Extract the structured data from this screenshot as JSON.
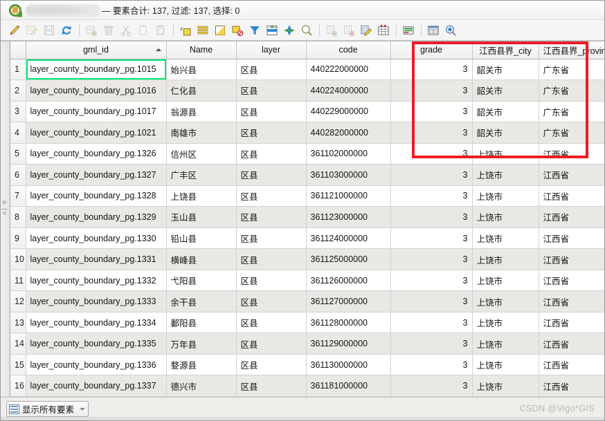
{
  "window": {
    "title_suffix": "— 要素合计: 137, 过滤: 137, 选择: 0",
    "logo_name": "qgis-logo",
    "redacted_label": ""
  },
  "toolbar": {
    "buttons": [
      {
        "name": "toggle-editing-icon",
        "title": "切换编辑模式",
        "enabled": true
      },
      {
        "name": "edit-form-icon",
        "title": "多字段编辑",
        "enabled": false
      },
      {
        "name": "save-edits-icon",
        "title": "保存编辑内容",
        "enabled": false
      },
      {
        "name": "reload-icon",
        "title": "重新载入表格",
        "enabled": true
      },
      {
        "name": "add-feature-icon",
        "title": "添加要素",
        "enabled": false
      },
      {
        "name": "delete-feature-icon",
        "title": "删除选中要素",
        "enabled": false
      },
      {
        "name": "cut-features-icon",
        "title": "剪切选中要素",
        "enabled": false
      },
      {
        "name": "copy-features-icon",
        "title": "复制选中要素",
        "enabled": false
      },
      {
        "name": "paste-features-icon",
        "title": "粘贴要素",
        "enabled": false
      },
      {
        "name": "select-by-expression-icon",
        "title": "使用表达式选择",
        "enabled": true
      },
      {
        "name": "select-all-icon",
        "title": "选择全部",
        "enabled": true
      },
      {
        "name": "invert-selection-icon",
        "title": "反转选择",
        "enabled": true
      },
      {
        "name": "deselect-all-icon",
        "title": "取消全部选择",
        "enabled": true
      },
      {
        "name": "filter-icon",
        "title": "过滤/选择要素",
        "enabled": true
      },
      {
        "name": "move-selection-top-icon",
        "title": "将选中行移到顶端",
        "enabled": true
      },
      {
        "name": "pan-to-selection-icon",
        "title": "平移到选中要素",
        "enabled": true
      },
      {
        "name": "zoom-to-selection-icon",
        "title": "缩放到选中要素",
        "enabled": true
      },
      {
        "name": "new-field-icon",
        "title": "新建字段",
        "enabled": false
      },
      {
        "name": "delete-field-icon",
        "title": "删除字段",
        "enabled": false
      },
      {
        "name": "field-calculator-icon",
        "title": "打开字段计算器",
        "enabled": true
      },
      {
        "name": "conditional-format-icon",
        "title": "条件格式",
        "enabled": true
      },
      {
        "name": "actions-icon",
        "title": "动作",
        "enabled": true
      },
      {
        "name": "form-view-icon",
        "title": "切换到表单视图",
        "enabled": true
      },
      {
        "name": "dock-icon",
        "title": "停靠属性表",
        "enabled": true
      }
    ]
  },
  "table": {
    "columns": [
      {
        "key": "rownum",
        "label": "",
        "align": "left"
      },
      {
        "key": "gml_id",
        "label": "gml_id",
        "align": "center",
        "sorted": "asc"
      },
      {
        "key": "name",
        "label": "Name",
        "align": "center"
      },
      {
        "key": "layer",
        "label": "layer",
        "align": "center"
      },
      {
        "key": "code",
        "label": "code",
        "align": "center"
      },
      {
        "key": "grade",
        "label": "grade",
        "align": "center"
      },
      {
        "key": "city",
        "label": "江西县界_city",
        "align": "center"
      },
      {
        "key": "prov",
        "label": "江西县界_province",
        "align": "center"
      }
    ],
    "rows": [
      {
        "rownum": "1",
        "gml_id": "layer_county_boundary_pg.1015",
        "name": "始兴县",
        "layer": "区县",
        "code": "440222000000",
        "grade": "3",
        "city": "韶关市",
        "prov": "广东省",
        "selected": true
      },
      {
        "rownum": "2",
        "gml_id": "layer_county_boundary_pg.1016",
        "name": "仁化县",
        "layer": "区县",
        "code": "440224000000",
        "grade": "3",
        "city": "韶关市",
        "prov": "广东省"
      },
      {
        "rownum": "3",
        "gml_id": "layer_county_boundary_pg.1017",
        "name": "翁源县",
        "layer": "区县",
        "code": "440229000000",
        "grade": "3",
        "city": "韶关市",
        "prov": "广东省"
      },
      {
        "rownum": "4",
        "gml_id": "layer_county_boundary_pg.1021",
        "name": "南雄市",
        "layer": "区县",
        "code": "440282000000",
        "grade": "3",
        "city": "韶关市",
        "prov": "广东省"
      },
      {
        "rownum": "5",
        "gml_id": "layer_county_boundary_pg.1326",
        "name": "信州区",
        "layer": "区县",
        "code": "361102000000",
        "grade": "3",
        "city": "上饶市",
        "prov": "江西省"
      },
      {
        "rownum": "6",
        "gml_id": "layer_county_boundary_pg.1327",
        "name": "广丰区",
        "layer": "区县",
        "code": "361103000000",
        "grade": "3",
        "city": "上饶市",
        "prov": "江西省"
      },
      {
        "rownum": "7",
        "gml_id": "layer_county_boundary_pg.1328",
        "name": "上饶县",
        "layer": "区县",
        "code": "361121000000",
        "grade": "3",
        "city": "上饶市",
        "prov": "江西省"
      },
      {
        "rownum": "8",
        "gml_id": "layer_county_boundary_pg.1329",
        "name": "玉山县",
        "layer": "区县",
        "code": "361123000000",
        "grade": "3",
        "city": "上饶市",
        "prov": "江西省"
      },
      {
        "rownum": "9",
        "gml_id": "layer_county_boundary_pg.1330",
        "name": "铅山县",
        "layer": "区县",
        "code": "361124000000",
        "grade": "3",
        "city": "上饶市",
        "prov": "江西省"
      },
      {
        "rownum": "10",
        "gml_id": "layer_county_boundary_pg.1331",
        "name": "横峰县",
        "layer": "区县",
        "code": "361125000000",
        "grade": "3",
        "city": "上饶市",
        "prov": "江西省"
      },
      {
        "rownum": "11",
        "gml_id": "layer_county_boundary_pg.1332",
        "name": "弋阳县",
        "layer": "区县",
        "code": "361126000000",
        "grade": "3",
        "city": "上饶市",
        "prov": "江西省"
      },
      {
        "rownum": "12",
        "gml_id": "layer_county_boundary_pg.1333",
        "name": "余干县",
        "layer": "区县",
        "code": "361127000000",
        "grade": "3",
        "city": "上饶市",
        "prov": "江西省"
      },
      {
        "rownum": "13",
        "gml_id": "layer_county_boundary_pg.1334",
        "name": "鄱阳县",
        "layer": "区县",
        "code": "361128000000",
        "grade": "3",
        "city": "上饶市",
        "prov": "江西省"
      },
      {
        "rownum": "14",
        "gml_id": "layer_county_boundary_pg.1335",
        "name": "万年县",
        "layer": "区县",
        "code": "361129000000",
        "grade": "3",
        "city": "上饶市",
        "prov": "江西省"
      },
      {
        "rownum": "15",
        "gml_id": "layer_county_boundary_pg.1336",
        "name": "婺源县",
        "layer": "区县",
        "code": "361130000000",
        "grade": "3",
        "city": "上饶市",
        "prov": "江西省"
      },
      {
        "rownum": "16",
        "gml_id": "layer_county_boundary_pg.1337",
        "name": "德兴市",
        "layer": "区县",
        "code": "361181000000",
        "grade": "3",
        "city": "上饶市",
        "prov": "江西省"
      }
    ]
  },
  "annotation": {
    "red_box_color": "#ec1c24",
    "selection_color": "#00e878"
  },
  "statusbar": {
    "filter_label": "显示所有要素",
    "watermark": "CSDN @Vigo*GIS"
  }
}
